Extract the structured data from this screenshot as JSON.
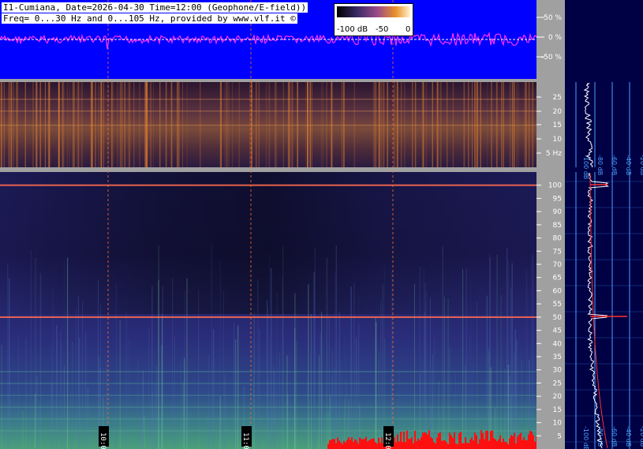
{
  "header": {
    "line1": "I1-Cumiana, Date=2026-04-30 Time=12:00 (Geophone/E-field))",
    "line2": "Freq= 0...30 Hz and 0...105 Hz, provided by www.vlf.it ©"
  },
  "legend": {
    "labels": [
      "-100 dB",
      "-50",
      "0"
    ]
  },
  "colors": {
    "waveform_bg": "#0000ff",
    "waveform": "#ff33ff",
    "low_panel_bg": "#1a0f2a",
    "low_panel_signal": "#d87a30",
    "high_panel_bg": "#20206a",
    "high_panel_low_band": "#46a88a",
    "noise_red": "#ff1010",
    "profile_bg": "#000044",
    "profile_grid": "#4aa0ff",
    "marker_line": "#ff7030"
  },
  "chart_data": [
    {
      "type": "line",
      "title": "",
      "ylabel": "",
      "ytick_labels": [
        "50 %",
        "0 %",
        "-50 %"
      ],
      "ylim": [
        -100,
        100
      ],
      "description_series": "Geophone/E-field waveform amplitude"
    },
    {
      "type": "heatmap",
      "ytick_labels": [
        "25",
        "20",
        "15",
        "10",
        "5 Hz"
      ],
      "ylim": [
        0,
        30
      ],
      "xtick_labels": [
        "10:00",
        "11:00",
        "12:00"
      ],
      "profile_tick_labels": [
        "-100 dB",
        "-80 dB",
        "-60 dB",
        "-40 dB",
        "-20 dB"
      ]
    },
    {
      "type": "heatmap",
      "ytick_labels": [
        "100",
        "95",
        "90",
        "85",
        "80",
        "75",
        "70",
        "65",
        "60",
        "55",
        "50",
        "45",
        "40",
        "35",
        "30",
        "25",
        "20",
        "15",
        "10",
        "5"
      ],
      "ylim": [
        0,
        105
      ],
      "xtick_labels": [
        "10:00",
        "11:00",
        "12:00"
      ],
      "profile_tick_labels": [
        "-100 dB",
        "-80 dB",
        "-60 dB",
        "-40 dB",
        "-20 dB"
      ],
      "lines_hz": [
        50,
        100
      ]
    }
  ]
}
